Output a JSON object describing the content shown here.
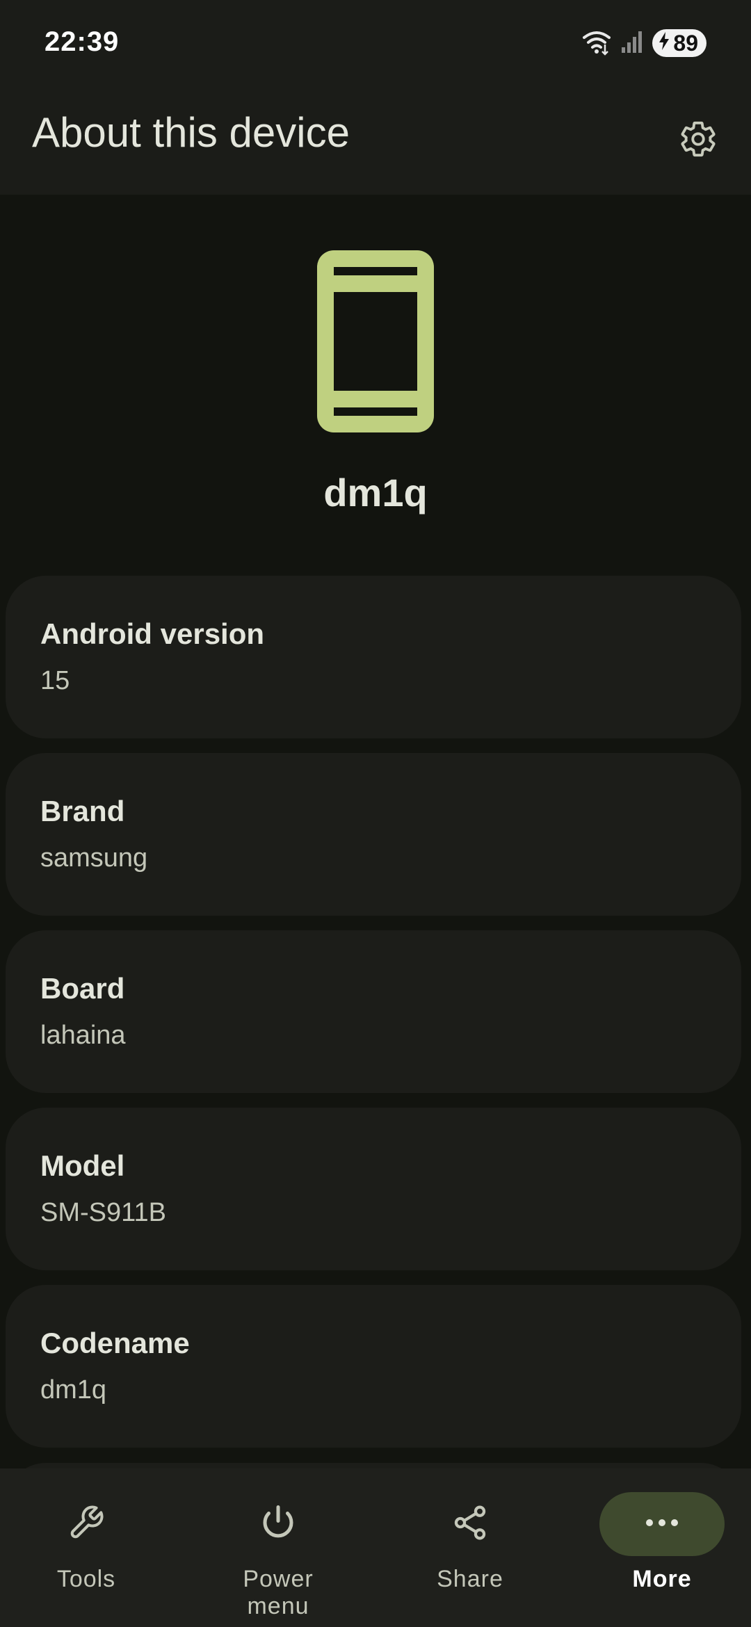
{
  "status_bar": {
    "time": "22:39",
    "battery_level": "89",
    "icons": [
      "wifi-icon",
      "cellular-signal-icon",
      "charging-bolt-icon"
    ]
  },
  "app_bar": {
    "title": "About this device",
    "settings_icon": "gear-icon"
  },
  "device": {
    "name": "dm1q",
    "icon": "smartphone-icon"
  },
  "cards": [
    {
      "title": "Android version",
      "value": "15"
    },
    {
      "title": "Brand",
      "value": "samsung"
    },
    {
      "title": "Board",
      "value": "lahaina"
    },
    {
      "title": "Model",
      "value": "SM-S911B"
    },
    {
      "title": "Codename",
      "value": "dm1q"
    }
  ],
  "bottom_nav": {
    "items": [
      {
        "label": "Tools",
        "icon": "wrench-icon",
        "active": false
      },
      {
        "label": "Power menu",
        "icon": "power-icon",
        "active": false
      },
      {
        "label": "Share",
        "icon": "share-icon",
        "active": false
      },
      {
        "label": "More",
        "icon": "more-horizontal-icon",
        "active": true
      }
    ]
  },
  "colors": {
    "background": "#12140f",
    "surface": "#1c1d19",
    "accent": "#bfd080",
    "active_indicator": "#3f4a2e"
  }
}
